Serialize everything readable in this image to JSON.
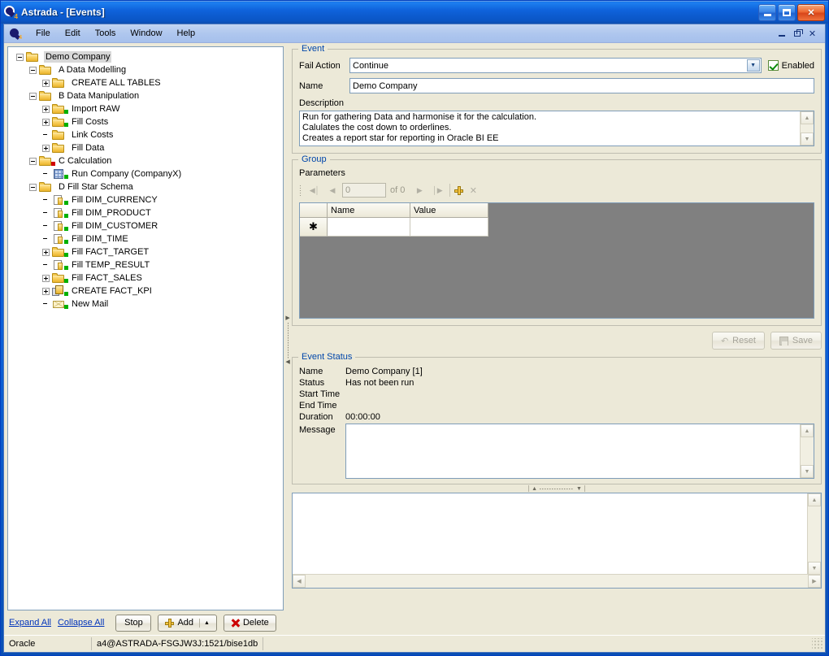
{
  "window": {
    "title": "Astrada - [Events]",
    "minimize_label": "Minimize",
    "maximize_label": "Maximize",
    "close_label": "Close"
  },
  "menubar": {
    "items": [
      {
        "label": "File"
      },
      {
        "label": "Edit"
      },
      {
        "label": "Tools"
      },
      {
        "label": "Window"
      },
      {
        "label": "Help"
      }
    ],
    "mdi": {
      "minimize_label": "Minimize",
      "restore_label": "Restore",
      "close_label": "Close",
      "close_glyph": "✕"
    }
  },
  "tree": {
    "nodes": [
      {
        "label": "Demo Company",
        "depth": 0,
        "expander": "minus",
        "icon": "folder",
        "badge": "none",
        "selected": true
      },
      {
        "label": "A Data Modelling",
        "depth": 1,
        "expander": "minus",
        "icon": "folder",
        "badge": "none",
        "selected": false
      },
      {
        "label": "CREATE ALL TABLES",
        "depth": 2,
        "expander": "plus",
        "icon": "folder",
        "badge": "none",
        "selected": false
      },
      {
        "label": "B Data Manipulation",
        "depth": 1,
        "expander": "minus",
        "icon": "folder",
        "badge": "none",
        "selected": false
      },
      {
        "label": "Import RAW",
        "depth": 2,
        "expander": "plus",
        "icon": "folder",
        "badge": "green",
        "selected": false
      },
      {
        "label": "Fill Costs",
        "depth": 2,
        "expander": "plus",
        "icon": "folder",
        "badge": "green",
        "selected": false
      },
      {
        "label": "Link Costs",
        "depth": 2,
        "expander": "none",
        "icon": "folder",
        "badge": "none",
        "selected": false
      },
      {
        "label": "Fill Data",
        "depth": 2,
        "expander": "plus",
        "icon": "folder",
        "badge": "none",
        "selected": false
      },
      {
        "label": "C Calculation",
        "depth": 1,
        "expander": "minus",
        "icon": "folder",
        "badge": "red",
        "selected": false
      },
      {
        "label": "Run Company (CompanyX)",
        "depth": 2,
        "expander": "none",
        "icon": "grid",
        "badge": "green",
        "selected": false
      },
      {
        "label": "D Fill Star Schema",
        "depth": 1,
        "expander": "minus",
        "icon": "folder",
        "badge": "none",
        "selected": false
      },
      {
        "label": "Fill DIM_CURRENCY",
        "depth": 2,
        "expander": "none",
        "icon": "doc",
        "badge": "green",
        "selected": false
      },
      {
        "label": "Fill DIM_PRODUCT",
        "depth": 2,
        "expander": "none",
        "icon": "doc",
        "badge": "green",
        "selected": false
      },
      {
        "label": "Fill DIM_CUSTOMER",
        "depth": 2,
        "expander": "none",
        "icon": "doc",
        "badge": "green",
        "selected": false
      },
      {
        "label": "Fill DIM_TIME",
        "depth": 2,
        "expander": "none",
        "icon": "doc",
        "badge": "green",
        "selected": false
      },
      {
        "label": "Fill FACT_TARGET",
        "depth": 2,
        "expander": "plus",
        "icon": "folder",
        "badge": "green",
        "selected": false
      },
      {
        "label": "Fill TEMP_RESULT",
        "depth": 2,
        "expander": "none",
        "icon": "doc",
        "badge": "green",
        "selected": false
      },
      {
        "label": "Fill FACT_SALES",
        "depth": 2,
        "expander": "plus",
        "icon": "folder",
        "badge": "green",
        "selected": false
      },
      {
        "label": "CREATE FACT_KPI",
        "depth": 2,
        "expander": "plus",
        "icon": "copy",
        "badge": "green",
        "selected": false
      },
      {
        "label": "New Mail",
        "depth": 2,
        "expander": "none",
        "icon": "mail",
        "badge": "green",
        "selected": false
      }
    ]
  },
  "tree_toolbar": {
    "expand_all": "Expand All",
    "collapse_all": "Collapse All",
    "stop": "Stop",
    "add": "Add",
    "add_dropdown_glyph": "▲",
    "delete": "Delete"
  },
  "event": {
    "legend": "Event",
    "fail_action_label": "Fail Action",
    "fail_action_value": "Continue",
    "fail_action_arrow": "▼",
    "enabled_label": "Enabled",
    "enabled_checked": true,
    "name_label": "Name",
    "name_value": "Demo Company",
    "description_label": "Description",
    "description_lines": [
      "Run for gathering Data and harmonise it for the calculation.",
      "Calulates the cost down to orderlines.",
      "Creates a report star for reporting in Oracle BI EE"
    ]
  },
  "group": {
    "legend": "Group",
    "parameters_label": "Parameters",
    "nav": {
      "first_glyph": "◀│",
      "prev_glyph": "◀",
      "record_value": "0",
      "of_text": "of 0",
      "next_glyph": "▶",
      "last_glyph": "│▶",
      "add_glyph": "+",
      "delete_glyph": "✕"
    },
    "grid": {
      "columns": [
        "Name",
        "Value"
      ],
      "new_row_marker": "✱",
      "rows": []
    }
  },
  "actions": {
    "reset_label": "Reset",
    "reset_icon_glyph": "↶",
    "save_label": "Save"
  },
  "event_status": {
    "legend": "Event Status",
    "rows": [
      {
        "key": "Name",
        "value": "Demo Company [1]"
      },
      {
        "key": "Status",
        "value": "Has not been run"
      },
      {
        "key": "Start Time",
        "value": ""
      },
      {
        "key": "End Time",
        "value": ""
      },
      {
        "key": "Duration",
        "value": "00:00:00"
      }
    ],
    "message_label": "Message",
    "message_value": ""
  },
  "splitter": {
    "vertical_up_glyph": "▶",
    "vertical_down_glyph": "◀",
    "horizontal_up_glyph": "▲",
    "horizontal_down_glyph": "▼"
  },
  "log_panel": {
    "content": "",
    "scroll_up_glyph": "▲",
    "scroll_down_glyph": "▼",
    "scroll_left_glyph": "◀",
    "scroll_right_glyph": "▶"
  },
  "statusbar": {
    "database_type": "Oracle",
    "connection": "a4@ASTRADA-FSGJW3J:1521/bise1db"
  }
}
